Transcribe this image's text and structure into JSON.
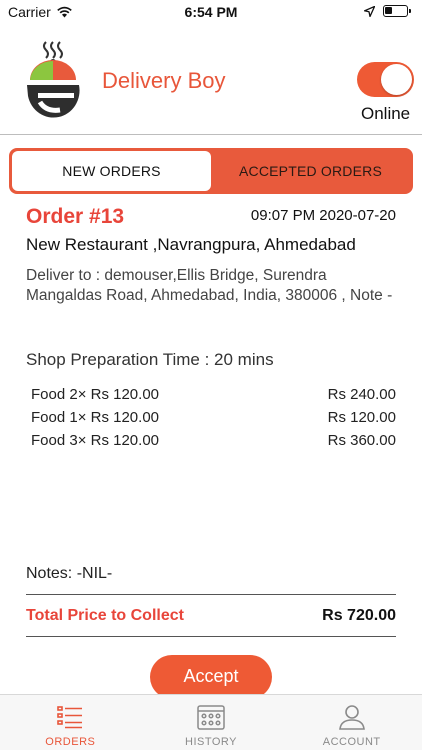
{
  "status": {
    "carrier": "Carrier",
    "time": "6:54 PM"
  },
  "header": {
    "title": "Delivery Boy",
    "online_label": "Online",
    "online": true
  },
  "tabs": {
    "new_orders": "NEW ORDERS",
    "accepted_orders": "ACCEPTED ORDERS"
  },
  "order": {
    "title": "Order  #13",
    "datetime": "09:07 PM 2020-07-20",
    "restaurant": "New Restaurant ,Navrangpura, Ahmedabad",
    "deliver_to": "Deliver to : demouser,Ellis Bridge, Surendra Mangaldas Road, Ahmedabad, India, 380006 , Note -",
    "prep_time": "Shop Preparation Time : 20 mins",
    "items": [
      {
        "desc": "Food  2× Rs 120.00",
        "price": "Rs 240.00"
      },
      {
        "desc": "Food  1× Rs 120.00",
        "price": "Rs 120.00"
      },
      {
        "desc": "Food  3× Rs 120.00",
        "price": "Rs 360.00"
      }
    ],
    "notes": "Notes: -NIL-",
    "total_label": "Total Price to Collect",
    "total_value": "Rs 720.00",
    "accept_label": "Accept"
  },
  "tabbar": {
    "orders": "ORDERS",
    "history": "HISTORY",
    "account": "ACCOUNT"
  },
  "colors": {
    "accent": "#e8563a",
    "toggle": "#ee5a35",
    "tab_inactive": "#8a8a8a"
  }
}
